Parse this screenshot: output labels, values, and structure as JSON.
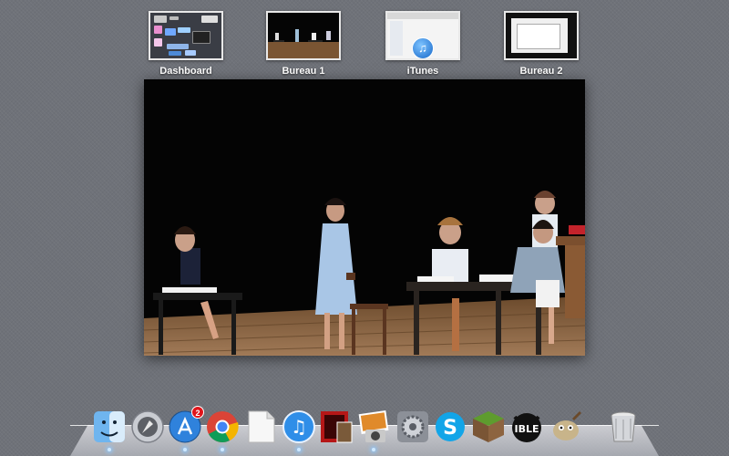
{
  "spaces": [
    {
      "label": "Dashboard"
    },
    {
      "label": "Bureau 1"
    },
    {
      "label": "iTunes"
    },
    {
      "label": "Bureau 2"
    }
  ],
  "main_window": {
    "content": "photo"
  },
  "dock": {
    "items": [
      {
        "name": "Finder",
        "icon": "finder-icon",
        "running": true
      },
      {
        "name": "Launchpad",
        "icon": "launchpad-icon",
        "running": false
      },
      {
        "name": "App Store",
        "icon": "app-store-icon",
        "running": true,
        "badge": "2"
      },
      {
        "name": "Google Chrome",
        "icon": "chrome-icon",
        "running": true
      },
      {
        "name": "Document",
        "icon": "document-icon",
        "running": false
      },
      {
        "name": "iTunes",
        "icon": "itunes-icon",
        "running": true
      },
      {
        "name": "Photo Booth",
        "icon": "photo-booth-icon",
        "running": false
      },
      {
        "name": "iPhoto",
        "icon": "iphoto-icon",
        "running": true
      },
      {
        "name": "System Preferences",
        "icon": "system-preferences-icon",
        "running": false
      },
      {
        "name": "Skype",
        "icon": "skype-icon",
        "running": false
      },
      {
        "name": "Minecraft",
        "icon": "minecraft-icon",
        "running": false
      },
      {
        "name": "IBLE",
        "icon": "ible-icon",
        "label": "IBLE",
        "running": false
      },
      {
        "name": "GIMP",
        "icon": "gimp-icon",
        "running": false
      },
      {
        "name": "Trash",
        "icon": "trash-icon",
        "running": false
      }
    ]
  }
}
